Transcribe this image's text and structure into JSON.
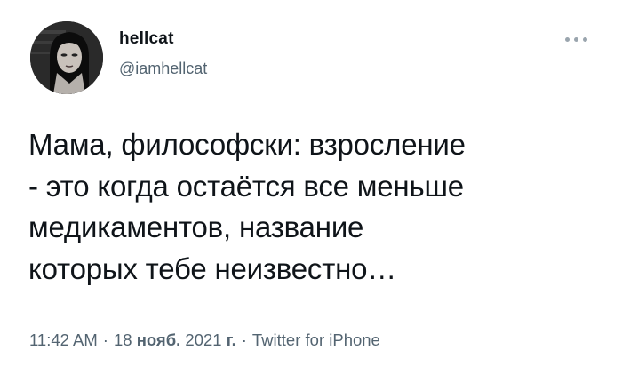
{
  "author": {
    "display_name": "hellcat",
    "handle": "@iamhellcat",
    "avatar_icon": "profile-photo-avatar"
  },
  "tweet": {
    "text_lines": [
      "Мама, философски: взросление",
      "- это когда остаётся все меньше",
      "медикаментов, название",
      "которых тебе неизвестно…"
    ]
  },
  "meta": {
    "time": "11:42 AM",
    "date_day": "18",
    "date_month": "нояб.",
    "date_year": "2021",
    "date_suffix": "г.",
    "separator": "·",
    "source": "Twitter for iPhone"
  },
  "more_icon": "more-horizontal-icon",
  "colors": {
    "text": "#0f1419",
    "secondary": "#536471",
    "background": "#ffffff"
  }
}
